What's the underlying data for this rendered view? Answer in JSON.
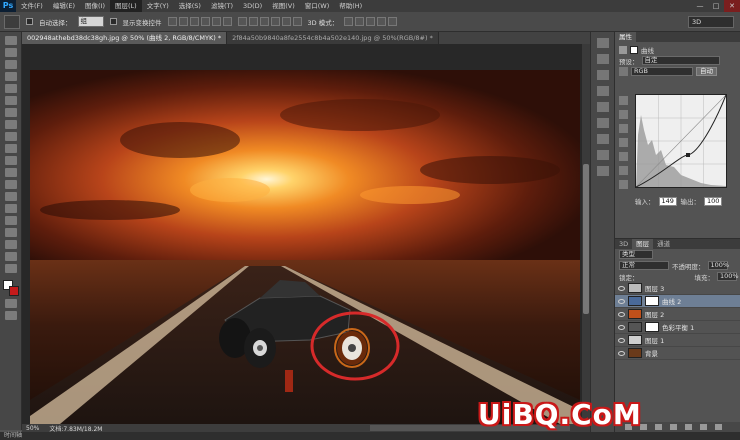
{
  "app": {
    "logo": "Ps"
  },
  "menu": [
    "文件(F)",
    "编辑(E)",
    "图像(I)",
    "图层(L)",
    "文字(Y)",
    "选择(S)",
    "滤镜(T)",
    "3D(D)",
    "视图(V)",
    "窗口(W)",
    "帮助(H)"
  ],
  "menu_active_index": 3,
  "window_controls": [
    "—",
    "□",
    "✕"
  ],
  "options": {
    "auto_select_label": "自动选择：",
    "auto_select_value": "组",
    "show_transform_label": "显示变换控件",
    "mode_3d_label": "3D 模式：",
    "workspace_value": "3D"
  },
  "tabs": [
    {
      "label": "002948athebd38dc38gh.jpg @ 50% (曲线 2, RGB/8/CMYK) *",
      "active": true
    },
    {
      "label": "2f84a50b9840a8fe2554c8b4a502e140.jpg @ 50%(RGB/8#) *",
      "active": false
    }
  ],
  "status": {
    "zoom": "50%",
    "doc": "文档:7.83M/18.2M"
  },
  "timeline_label": "时间轴",
  "properties": {
    "tab": "属性",
    "title": "曲线",
    "preset_label": "预设：",
    "preset_value": "自定",
    "channel_value": "RGB",
    "auto_label": "自动",
    "input_label": "输入：",
    "input_value": "149",
    "output_label": "输出：",
    "output_value": "100"
  },
  "layers_panel": {
    "tabs": [
      "3D",
      "图层",
      "通道"
    ],
    "kind_label": "类型",
    "blend_mode": "正常",
    "opacity_label": "不透明度：",
    "opacity_value": "100%",
    "lock_label": "锁定：",
    "fill_label": "填充：",
    "fill_value": "100%",
    "layers": [
      {
        "name": "图层 3",
        "selected": false,
        "has_mask": false,
        "thumb": "#bbbbbb"
      },
      {
        "name": "曲线 2",
        "selected": true,
        "has_mask": true,
        "thumb": "#4a6a9a"
      },
      {
        "name": "图层 2",
        "selected": false,
        "has_mask": false,
        "thumb": "#c0501a"
      },
      {
        "name": "色彩平衡 1",
        "selected": false,
        "has_mask": true,
        "thumb": "#555555"
      },
      {
        "name": "图层 1",
        "selected": false,
        "has_mask": false,
        "thumb": "#cfcfcf"
      },
      {
        "name": "背景",
        "selected": false,
        "has_mask": false,
        "thumb": "#6a3a1a"
      }
    ]
  },
  "watermark": "UiBQ.CoM",
  "colors": {
    "foreground": "#ffffff",
    "background": "#c41b1b",
    "accent_circle": "#d62a2a"
  }
}
